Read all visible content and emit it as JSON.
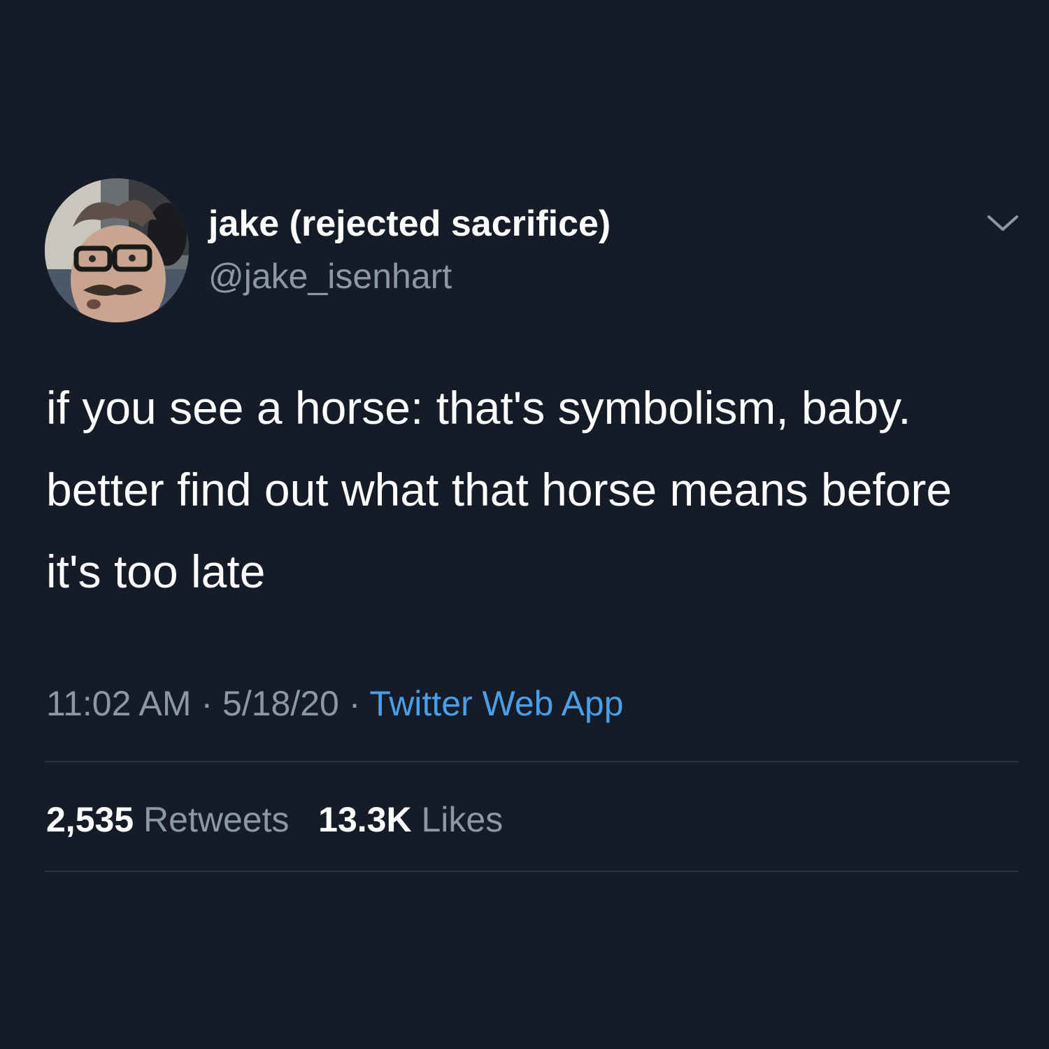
{
  "tweet": {
    "display_name": "jake (rejected sacrifice)",
    "handle": "@jake_isenhart",
    "text": "if you see a horse: that's symbolism, baby. better find out what that horse means before it's too late",
    "time": "11:02 AM",
    "separator": "·",
    "date": "5/18/20",
    "source": "Twitter Web App",
    "retweets_count": "2,535",
    "retweets_label": "Retweets",
    "likes_count": "13.3K",
    "likes_label": "Likes"
  },
  "icons": {
    "menu": "chevron-down-icon"
  },
  "colors": {
    "background": "#161c27",
    "text_primary": "#ffffff",
    "text_secondary": "#8b98a5",
    "link": "#4a9fe8",
    "divider": "#2b3440"
  }
}
